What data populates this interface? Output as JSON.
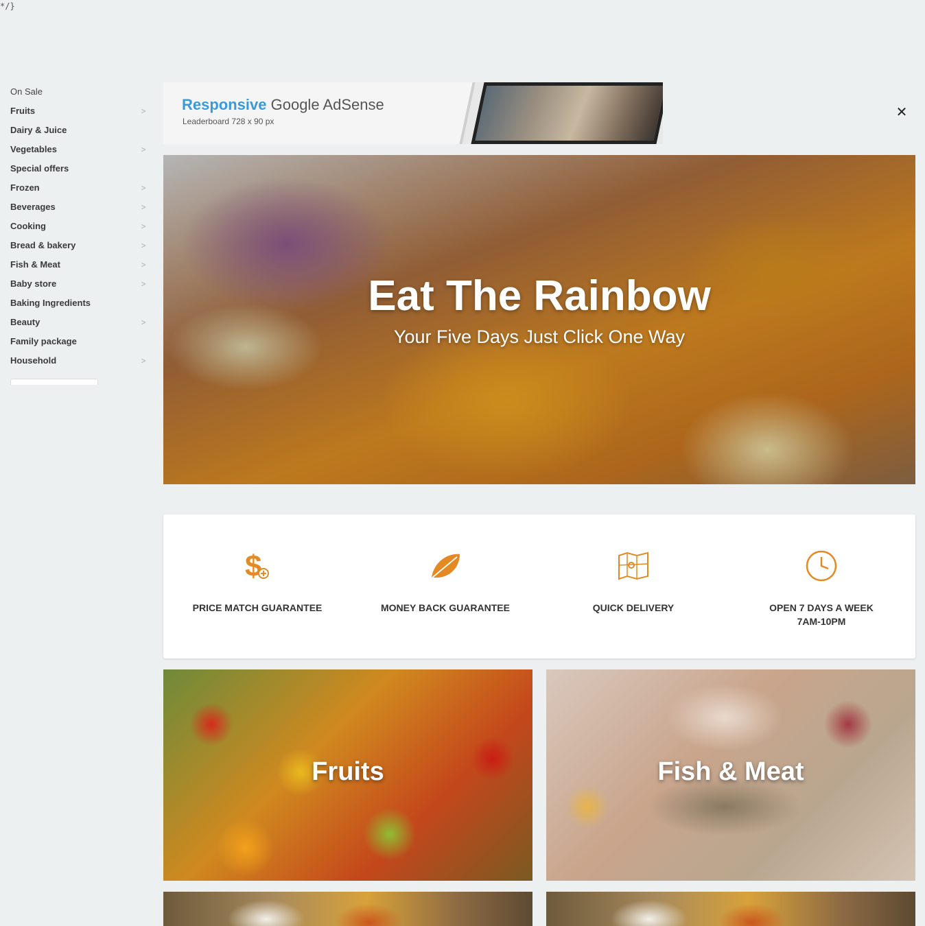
{
  "stray_text": "*/}",
  "sidebar": {
    "items": [
      {
        "label": "On Sale",
        "chevron": false,
        "bold": false
      },
      {
        "label": "Fruits",
        "chevron": true,
        "bold": true
      },
      {
        "label": "Dairy & Juice",
        "chevron": false,
        "bold": true
      },
      {
        "label": "Vegetables",
        "chevron": true,
        "bold": true
      },
      {
        "label": "Special offers",
        "chevron": false,
        "bold": true
      },
      {
        "label": "Frozen",
        "chevron": true,
        "bold": true
      },
      {
        "label": "Beverages",
        "chevron": true,
        "bold": true
      },
      {
        "label": "Cooking",
        "chevron": true,
        "bold": true
      },
      {
        "label": "Bread & bakery",
        "chevron": true,
        "bold": true
      },
      {
        "label": "Fish & Meat",
        "chevron": true,
        "bold": true
      },
      {
        "label": "Baby store",
        "chevron": true,
        "bold": true
      },
      {
        "label": "Baking Ingredients",
        "chevron": false,
        "bold": true
      },
      {
        "label": "Beauty",
        "chevron": true,
        "bold": true
      },
      {
        "label": "Family package",
        "chevron": false,
        "bold": true
      },
      {
        "label": "Household",
        "chevron": true,
        "bold": true
      }
    ],
    "chevron_glyph": ">"
  },
  "ad": {
    "title_highlight": "Responsive",
    "title_rest": " Google AdSense",
    "subtitle": "Leaderboard 728 x 90 px",
    "close_glyph": "✕"
  },
  "hero": {
    "title": "Eat The Rainbow",
    "subtitle": "Your Five Days Just Click One Way"
  },
  "features": [
    {
      "icon": "dollar-plus-icon",
      "label": "PRICE MATCH GUARANTEE"
    },
    {
      "icon": "leaf-icon",
      "label": "MONEY BACK GUARANTEE"
    },
    {
      "icon": "map-icon",
      "label": "QUICK DELIVERY"
    },
    {
      "icon": "clock-icon",
      "label": "OPEN 7 DAYS A WEEK\n7AM-10PM"
    }
  ],
  "categories": [
    {
      "title": "Fruits"
    },
    {
      "title": "Fish & Meat"
    }
  ],
  "colors": {
    "accent": "#e38a24",
    "ad_highlight": "#3a9ad9",
    "background": "#edf0f1"
  }
}
